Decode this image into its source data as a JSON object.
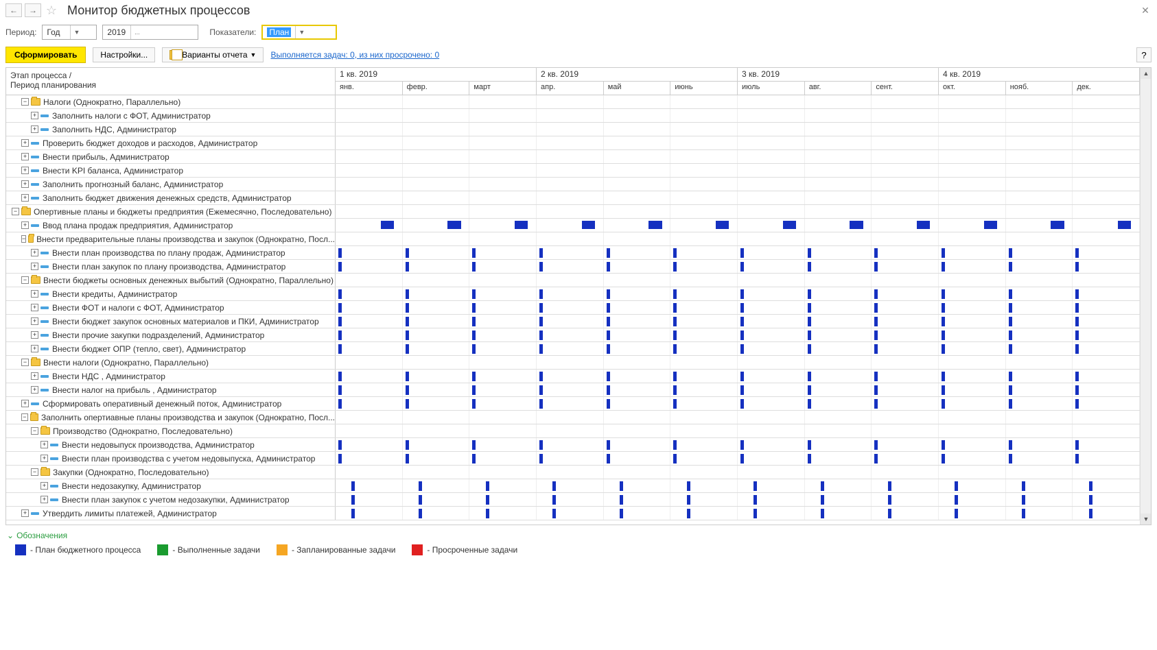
{
  "title": "Монитор бюджетных процессов",
  "period_label": "Период:",
  "period_type": "Год",
  "period_value": "2019",
  "indicator_label": "Показатели:",
  "indicator_value": "План",
  "form_btn": "Сформировать",
  "settings_btn": "Настройки...",
  "variants_btn": "Варианты отчета",
  "tasks_link": "Выполняется задач: 0, из них просрочено: 0",
  "head_left1": "Этап процесса /",
  "head_left2": "Период планирования",
  "quarters": [
    "1 кв. 2019",
    "2 кв. 2019",
    "3 кв. 2019",
    "4 кв. 2019"
  ],
  "months": [
    "янв.",
    "февр.",
    "март",
    "апр.",
    "май",
    "июнь",
    "июль",
    "авг.",
    "сент.",
    "окт.",
    "нояб.",
    "дек."
  ],
  "rows": [
    {
      "d": 1,
      "t": "folder",
      "e": "-",
      "txt": "Налоги (Однократно, Параллельно)",
      "b": null
    },
    {
      "d": 2,
      "t": "task",
      "e": "+",
      "txt": "Заполнить налоги с ФОТ, Администратор",
      "b": null
    },
    {
      "d": 2,
      "t": "task",
      "e": "+",
      "txt": "Заполнить НДС, Администратор",
      "b": null
    },
    {
      "d": 1,
      "t": "task",
      "e": "+",
      "txt": "Проверить бюджет доходов и расходов, Администратор",
      "b": null
    },
    {
      "d": 1,
      "t": "task",
      "e": "+",
      "txt": "Внести прибыль, Администратор",
      "b": null
    },
    {
      "d": 1,
      "t": "task",
      "e": "+",
      "txt": "Внести KPI баланса, Администратор",
      "b": null
    },
    {
      "d": 1,
      "t": "task",
      "e": "+",
      "txt": "Заполнить прогнозный баланс, Администратор",
      "b": null
    },
    {
      "d": 1,
      "t": "task",
      "e": "+",
      "txt": "Заполнить бюджет движения денежных средств, Администратор",
      "b": null
    },
    {
      "d": 0,
      "t": "folder",
      "e": "-",
      "txt": "Опертивные планы и бюджеты предприятия (Ежемесячно, Последовательно)",
      "b": null
    },
    {
      "d": 1,
      "t": "task",
      "e": "+",
      "txt": "Ввод плана продаж предприятия, Администратор",
      "b": "wide"
    },
    {
      "d": 1,
      "t": "folder",
      "e": "-",
      "txt": "Внести предварительные планы производства и закупок (Однократно, Посл...",
      "b": null
    },
    {
      "d": 2,
      "t": "task",
      "e": "+",
      "txt": "Внести план производства по плану продаж, Администратор",
      "b": "narrow"
    },
    {
      "d": 2,
      "t": "task",
      "e": "+",
      "txt": "Внести план закупок по плану производства, Администратор",
      "b": "narrow"
    },
    {
      "d": 1,
      "t": "folder",
      "e": "-",
      "txt": "Внести бюджеты основных денежных выбытий (Однократно, Параллельно)",
      "b": null
    },
    {
      "d": 2,
      "t": "task",
      "e": "+",
      "txt": "Внести кредиты, Администратор",
      "b": "narrow"
    },
    {
      "d": 2,
      "t": "task",
      "e": "+",
      "txt": "Внести ФОТ и налоги с ФОТ, Администратор",
      "b": "narrow"
    },
    {
      "d": 2,
      "t": "task",
      "e": "+",
      "txt": "Внести бюджет закупок основных материалов и ПКИ, Администратор",
      "b": "narrow"
    },
    {
      "d": 2,
      "t": "task",
      "e": "+",
      "txt": "Внести прочие закупки подразделений, Администратор",
      "b": "narrow"
    },
    {
      "d": 2,
      "t": "task",
      "e": "+",
      "txt": "Внести бюджет ОПР (тепло, свет), Администратор",
      "b": "narrow"
    },
    {
      "d": 1,
      "t": "folder",
      "e": "-",
      "txt": "Внести налоги (Однократно, Параллельно)",
      "b": null
    },
    {
      "d": 2,
      "t": "task",
      "e": "+",
      "txt": "Внести НДС , Администратор",
      "b": "narrow"
    },
    {
      "d": 2,
      "t": "task",
      "e": "+",
      "txt": "Внести налог на прибыль , Администратор",
      "b": "narrow"
    },
    {
      "d": 1,
      "t": "task",
      "e": "+",
      "txt": "Сформировать оперативный денежный поток, Администратор",
      "b": "narrow"
    },
    {
      "d": 1,
      "t": "folder",
      "e": "-",
      "txt": "Заполнить опертиавные планы производства и закупок (Однократно, Посл...",
      "b": null
    },
    {
      "d": 2,
      "t": "folder",
      "e": "-",
      "txt": "Производство (Однократно, Последовательно)",
      "b": null
    },
    {
      "d": 3,
      "t": "task",
      "e": "+",
      "txt": "Внести недовыпуск производства, Администратор",
      "b": "narrow"
    },
    {
      "d": 3,
      "t": "task",
      "e": "+",
      "txt": "Внести план производства с учетом недовыпуска, Администратор",
      "b": "narrow"
    },
    {
      "d": 2,
      "t": "folder",
      "e": "-",
      "txt": "Закупки (Однократно, Последовательно)",
      "b": null
    },
    {
      "d": 3,
      "t": "task",
      "e": "+",
      "txt": "Внести недозакупку, Администратор",
      "b": "narrow2"
    },
    {
      "d": 3,
      "t": "task",
      "e": "+",
      "txt": "Внести план закупок с учетом недозакупки, Администратор",
      "b": "narrow2"
    },
    {
      "d": 1,
      "t": "task",
      "e": "+",
      "txt": "Утвердить лимиты платежей, Администратор",
      "b": "narrow2"
    }
  ],
  "legend_title": "Обозначения",
  "legend": [
    {
      "c": "sw-blue",
      "txt": "- План бюджетного процесса"
    },
    {
      "c": "sw-green",
      "txt": "- Выполненные задачи"
    },
    {
      "c": "sw-orange",
      "txt": "- Запланированные задачи"
    },
    {
      "c": "sw-red",
      "txt": "- Просроченные задачи"
    }
  ]
}
